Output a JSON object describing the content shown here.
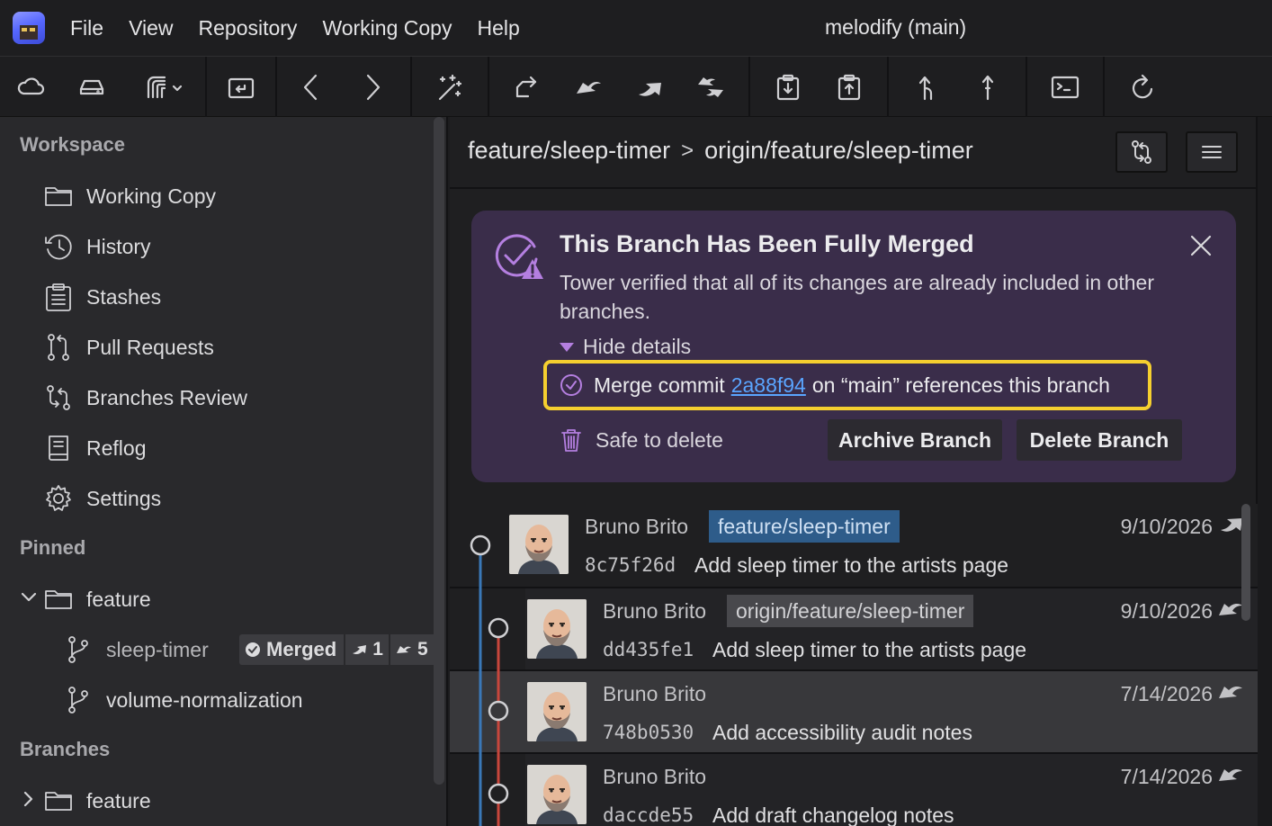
{
  "app": {
    "window_title": "melodify (main)",
    "menus": [
      "File",
      "View",
      "Repository",
      "Working Copy",
      "Help"
    ]
  },
  "toolbar": {
    "buttons": [
      "cloud-icon",
      "drive-icon",
      "services-icon",
      "open-repo-icon",
      "back-icon",
      "forward-icon",
      "magic-wand-icon",
      "fetch-icon",
      "pull-icon",
      "push-icon",
      "sync-icon",
      "stash-icon",
      "pop-stash-icon",
      "branch-icon",
      "tag-icon",
      "terminal-icon",
      "refresh-icon"
    ]
  },
  "sidebar": {
    "workspace_title": "Workspace",
    "workspace_items": [
      {
        "label": "Working Copy",
        "icon": "folder-icon"
      },
      {
        "label": "History",
        "icon": "history-icon"
      },
      {
        "label": "Stashes",
        "icon": "clipboard-icon"
      },
      {
        "label": "Pull Requests",
        "icon": "pull-request-icon"
      },
      {
        "label": "Branches Review",
        "icon": "branches-review-icon"
      },
      {
        "label": "Reflog",
        "icon": "book-icon"
      },
      {
        "label": "Settings",
        "icon": "gear-icon"
      }
    ],
    "pinned_title": "Pinned",
    "pinned_folder": "feature",
    "pinned_branches": [
      {
        "label": "sleep-timer",
        "status": "Merged",
        "ahead": "1",
        "behind": "5"
      },
      {
        "label": "volume-normalization"
      }
    ],
    "branches_title": "Branches",
    "branches_folder": "feature"
  },
  "main": {
    "breadcrumb": {
      "local": "feature/sleep-timer",
      "separator": ">",
      "remote": "origin/feature/sleep-timer"
    },
    "banner": {
      "title": "This Branch Has Been Fully Merged",
      "description": "Tower verified that all of its changes are already included in other branches.",
      "toggle_label": "Hide details",
      "detail_prefix": "Merge commit",
      "detail_link": "2a88f94",
      "detail_suffix": "on “main” references this branch",
      "safe_label": "Safe to delete",
      "archive_label": "Archive Branch",
      "delete_label": "Delete Branch",
      "accent_color": "#b47fe0",
      "highlight_color": "#f5cf2f"
    },
    "commits": [
      {
        "author": "Bruno Brito",
        "tag": "feature/sleep-timer",
        "hash": "8c75f26d",
        "message": "Add sleep timer to the artists page",
        "date": "9/10/2026",
        "direction": "push"
      },
      {
        "author": "Bruno Brito",
        "tag": "origin/feature/sleep-timer",
        "hash": "dd435fe1",
        "message": "Add sleep timer to the artists page",
        "date": "9/10/2026",
        "direction": "pull"
      },
      {
        "author": "Bruno Brito",
        "tag": "",
        "hash": "748b0530",
        "message": "Add accessibility audit notes",
        "date": "7/14/2026",
        "direction": "pull"
      },
      {
        "author": "Bruno Brito",
        "tag": "",
        "hash": "daccde55",
        "message": "Add draft changelog notes",
        "date": "7/14/2026",
        "direction": "pull"
      }
    ]
  }
}
